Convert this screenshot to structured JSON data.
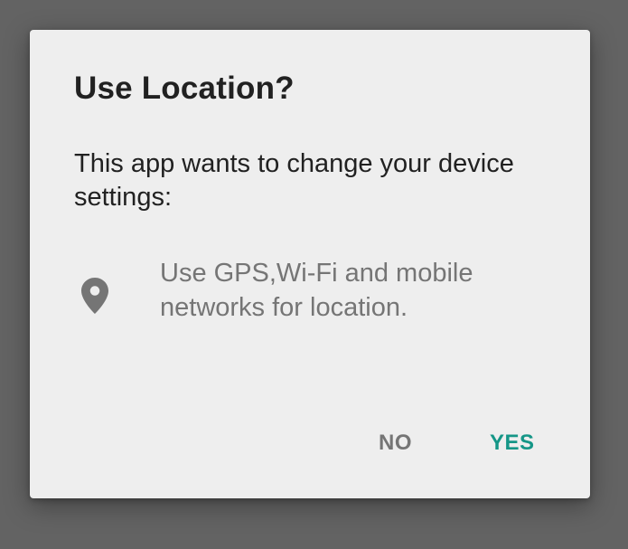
{
  "dialog": {
    "title": "Use Location?",
    "message": "This app wants to change your device settings:",
    "permission": {
      "icon": "location-pin-icon",
      "text": "Use GPS,Wi-Fi and mobile networks for location."
    },
    "buttons": {
      "no_label": "NO",
      "yes_label": "YES"
    }
  },
  "colors": {
    "scrim": "#636363",
    "dialog_background": "#eeeeee",
    "title_text": "#212121",
    "secondary_text": "#757575",
    "accent": "#159687"
  }
}
